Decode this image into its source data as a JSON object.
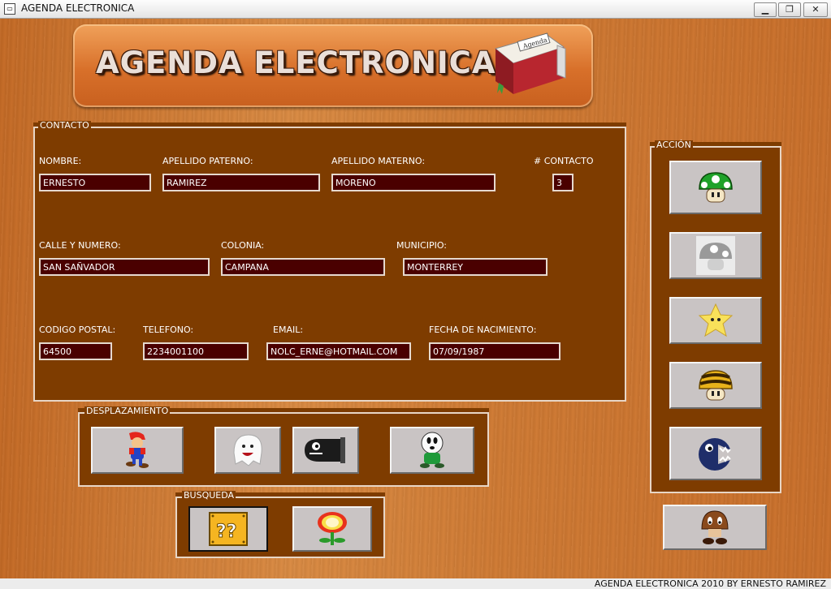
{
  "window": {
    "title": "AGENDA ELECTRONICA",
    "minimize": "▁",
    "restore": "❐",
    "close": "✕"
  },
  "banner": {
    "title": "AGENDA ELECTRONICA",
    "book_label": "Agenda"
  },
  "contacto": {
    "legend": "CONTACTO",
    "fields": {
      "nombre": {
        "label": "NOMBRE:",
        "value": "ERNESTO"
      },
      "apellido_paterno": {
        "label": "APELLIDO PATERNO:",
        "value": "RAMIREZ"
      },
      "apellido_materno": {
        "label": "APELLIDO MATERNO:",
        "value": "MORENO"
      },
      "num_contacto": {
        "label": "# CONTACTO",
        "value": "3"
      },
      "calle": {
        "label": "CALLE Y NUMERO:",
        "value": "SAN SAÑVADOR"
      },
      "colonia": {
        "label": "COLONIA:",
        "value": "CAMPANA"
      },
      "municipio": {
        "label": "MUNICIPIO:",
        "value": "MONTERREY"
      },
      "codigo_postal": {
        "label": "CODIGO POSTAL:",
        "value": "64500"
      },
      "telefono": {
        "label": "TELEFONO:",
        "value": "2234001100"
      },
      "email": {
        "label": "EMAIL:",
        "value": "NOLC_ERNE@HOTMAIL.COM"
      },
      "fecha": {
        "label": "FECHA DE NACIMIENTO:",
        "value": "07/09/1987"
      }
    }
  },
  "accion": {
    "legend": "ACCIÓN",
    "buttons": [
      "green-mushroom-icon",
      "grey-mushroom-icon",
      "star-icon",
      "bee-mushroom-icon",
      "chain-chomp-icon"
    ]
  },
  "desplazamiento": {
    "legend": "DESPLAZAMIENTO",
    "buttons": [
      "mario-icon",
      "boo-ghost-icon",
      "bullet-bill-icon",
      "shy-guy-icon"
    ]
  },
  "busqueda": {
    "legend": "BUSQUEDA",
    "buttons": [
      "question-block-icon",
      "fire-flower-icon"
    ]
  },
  "exit_button": {
    "icon": "goomba-icon"
  },
  "status": {
    "text": "AGENDA ELECTRONICA 2010  BY ERNESTO RAMIREZ"
  },
  "colors": {
    "wood": "#c8712b",
    "panel": "#7e3c00",
    "field": "#4a0000",
    "button": "#c9c4c4"
  }
}
